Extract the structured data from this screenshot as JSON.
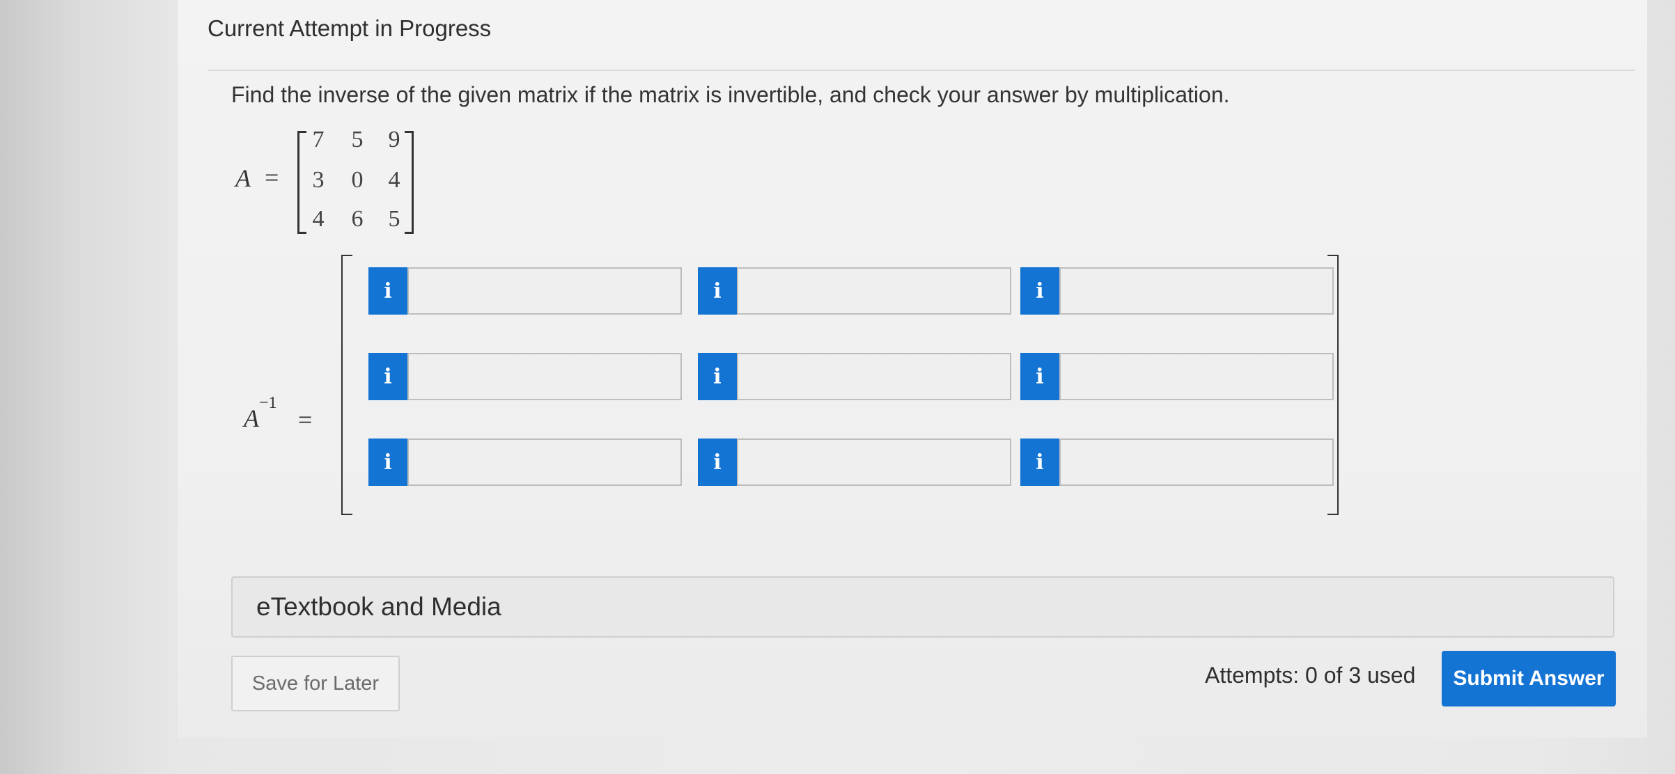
{
  "header": {
    "title": "Current Attempt in Progress"
  },
  "question": {
    "text": "Find the inverse of the given matrix if the matrix is invertible, and check your answer by multiplication.",
    "matrix_label": "A",
    "equals": "=",
    "matrix_a": [
      [
        "7",
        "5",
        "9"
      ],
      [
        "3",
        "0",
        "4"
      ],
      [
        "4",
        "6",
        "5"
      ]
    ],
    "inverse_label": "A",
    "inverse_exponent": "−1"
  },
  "answer_grid": {
    "info_icon_glyph": "i",
    "cells": [
      [
        "",
        "",
        ""
      ],
      [
        "",
        "",
        ""
      ],
      [
        "",
        "",
        ""
      ]
    ]
  },
  "etextbook": {
    "label": "eTextbook and Media"
  },
  "footer": {
    "save_label": "Save for Later",
    "attempts_text": "Attempts: 0 of 3 used",
    "submit_label": "Submit Answer"
  },
  "colors": {
    "accent": "#1474d4",
    "background": "#f0f0f0"
  }
}
